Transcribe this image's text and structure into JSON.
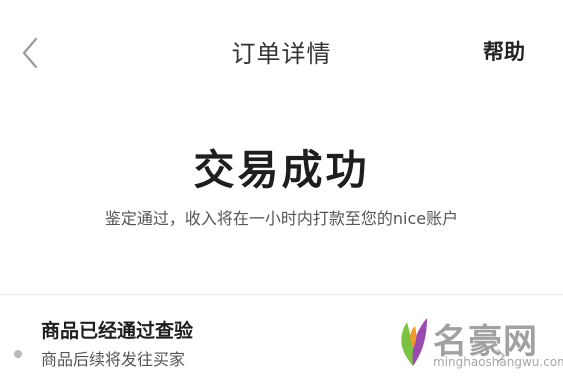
{
  "nav": {
    "back_icon": "chevron-left-icon",
    "title": "订单详情",
    "help_label": "帮助"
  },
  "status": {
    "title": "交易成功",
    "description": "鉴定通过，收入将在一小时内打款至您的nice账户"
  },
  "progress_step": {
    "title": "商品已经通过查验",
    "subtitle": "商品后续将发往买家",
    "dot_icon": "timeline-dot-icon",
    "arrow_icon": "chevron-right-icon"
  },
  "watermark": {
    "text": "名豪网",
    "url": "minghaoshangwu.com",
    "colors": {
      "leaf_green": "#7cc242",
      "leaf_purple": "#9b4ab0",
      "leaf_orange": "#f29b2a"
    }
  }
}
